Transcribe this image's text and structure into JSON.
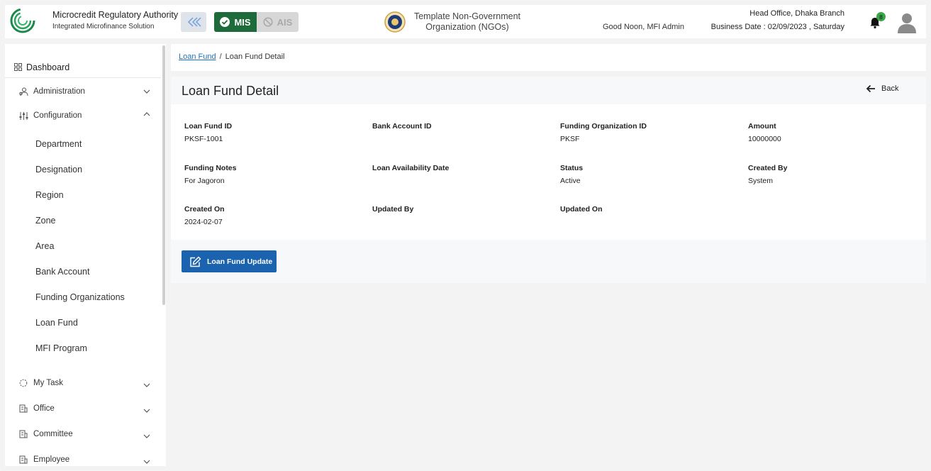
{
  "header": {
    "logo_text": "Microcredit Regulatory Authority",
    "brand_title": "Microcredit Regulatory Authority",
    "brand_subtitle": "Integrated Microfinance Solution",
    "modes": {
      "mis": "MIS",
      "ais": "AIS"
    },
    "org_name": "Template Non-Government Organization (NGOs)",
    "greeting": "Good Noon, MFI Admin",
    "branch": "Head Office, Dhaka Branch",
    "business_date": "Business Date : 02/09/2023 , Saturday",
    "notification_count": "8",
    "colors": {
      "mis_active": "#1d6b3a",
      "primary": "#1b63ae",
      "badge": "#3aa64a"
    }
  },
  "sidebar": {
    "dashboard": "Dashboard",
    "administration": "Administration",
    "configuration": "Configuration",
    "config_items": [
      "Department",
      "Designation",
      "Region",
      "Zone",
      "Area",
      "Bank Account",
      "Funding Organizations",
      "Loan Fund",
      "MFI Program"
    ],
    "my_task": "My Task",
    "office": "Office",
    "committee": "Committee",
    "employee": "Employee"
  },
  "breadcrumb": {
    "parent": "Loan Fund",
    "current": "Loan Fund Detail"
  },
  "detail": {
    "title": "Loan Fund Detail",
    "back_label": "Back",
    "fields": [
      {
        "label": "Loan Fund ID",
        "value": "PKSF-1001"
      },
      {
        "label": "Bank Account ID",
        "value": ""
      },
      {
        "label": "Funding Organization ID",
        "value": "PKSF"
      },
      {
        "label": "Amount",
        "value": "10000000"
      },
      {
        "label": "Funding Notes",
        "value": "For Jagoron"
      },
      {
        "label": "Loan Availability Date",
        "value": ""
      },
      {
        "label": "Status",
        "value": "Active"
      },
      {
        "label": "Created By",
        "value": "System"
      },
      {
        "label": "Created On",
        "value": "2024-02-07"
      },
      {
        "label": "Updated By",
        "value": ""
      },
      {
        "label": "Updated On",
        "value": ""
      }
    ],
    "update_button": "Loan Fund Update"
  }
}
